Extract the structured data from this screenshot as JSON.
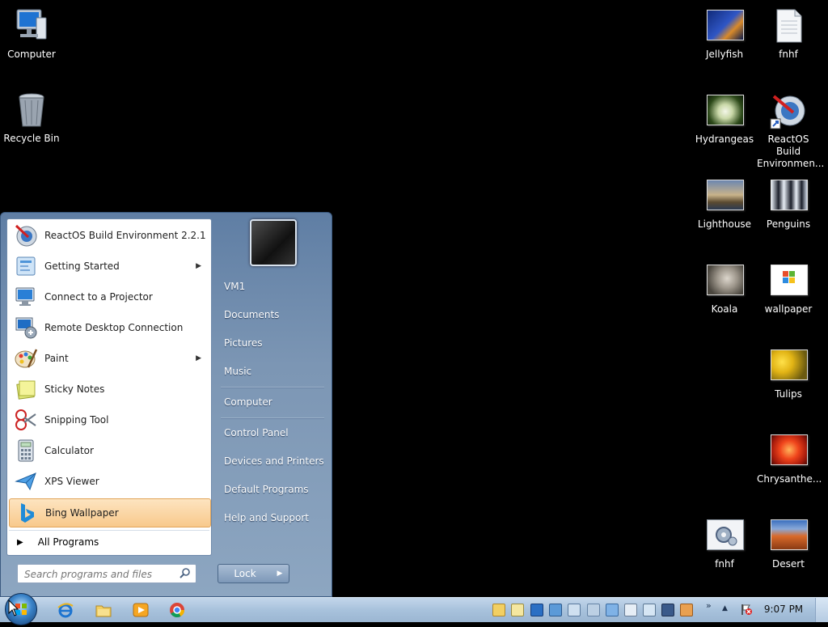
{
  "desktop": {
    "icons": [
      {
        "label": "Computer"
      },
      {
        "label": "Recycle Bin"
      },
      {
        "label": "Jellyfish"
      },
      {
        "label": "fnhf"
      },
      {
        "label": "Hydrangeas"
      },
      {
        "label": "ReactOS Build Environmen..."
      },
      {
        "label": "Lighthouse"
      },
      {
        "label": "Penguins"
      },
      {
        "label": "Koala"
      },
      {
        "label": "wallpaper"
      },
      {
        "label": "Tulips"
      },
      {
        "label": "Chrysanthe..."
      },
      {
        "label": "fnhf"
      },
      {
        "label": "Desert"
      }
    ]
  },
  "start_menu": {
    "programs": [
      {
        "label": "ReactOS Build Environment 2.2.1",
        "icon": "reactos-icon"
      },
      {
        "label": "Getting Started",
        "icon": "getting-started-icon",
        "submenu": true
      },
      {
        "label": "Connect to a Projector",
        "icon": "projector-icon"
      },
      {
        "label": "Remote Desktop Connection",
        "icon": "remote-desktop-icon"
      },
      {
        "label": "Paint",
        "icon": "paint-icon",
        "submenu": true
      },
      {
        "label": "Sticky Notes",
        "icon": "sticky-notes-icon"
      },
      {
        "label": "Snipping Tool",
        "icon": "snipping-tool-icon"
      },
      {
        "label": "Calculator",
        "icon": "calculator-icon"
      },
      {
        "label": "XPS Viewer",
        "icon": "xps-viewer-icon"
      },
      {
        "label": "Bing Wallpaper",
        "icon": "bing-icon",
        "highlighted": true
      }
    ],
    "all_programs": "All Programs",
    "search_placeholder": "Search programs and files",
    "right_links": [
      "VM1",
      "Documents",
      "Pictures",
      "Music",
      "Computer",
      "Control Panel",
      "Devices and Printers",
      "Default Programs",
      "Help and Support"
    ],
    "lock_label": "Lock"
  },
  "taskbar": {
    "pinned": [
      "internet-explorer-icon",
      "explorer-folder-icon",
      "media-player-icon",
      "chrome-icon"
    ],
    "clock": "9:07 PM"
  },
  "colors": {
    "highlight": "#f8c98c",
    "start_menu_right": "#7c96b4",
    "taskbar": "#a8c2dc"
  }
}
